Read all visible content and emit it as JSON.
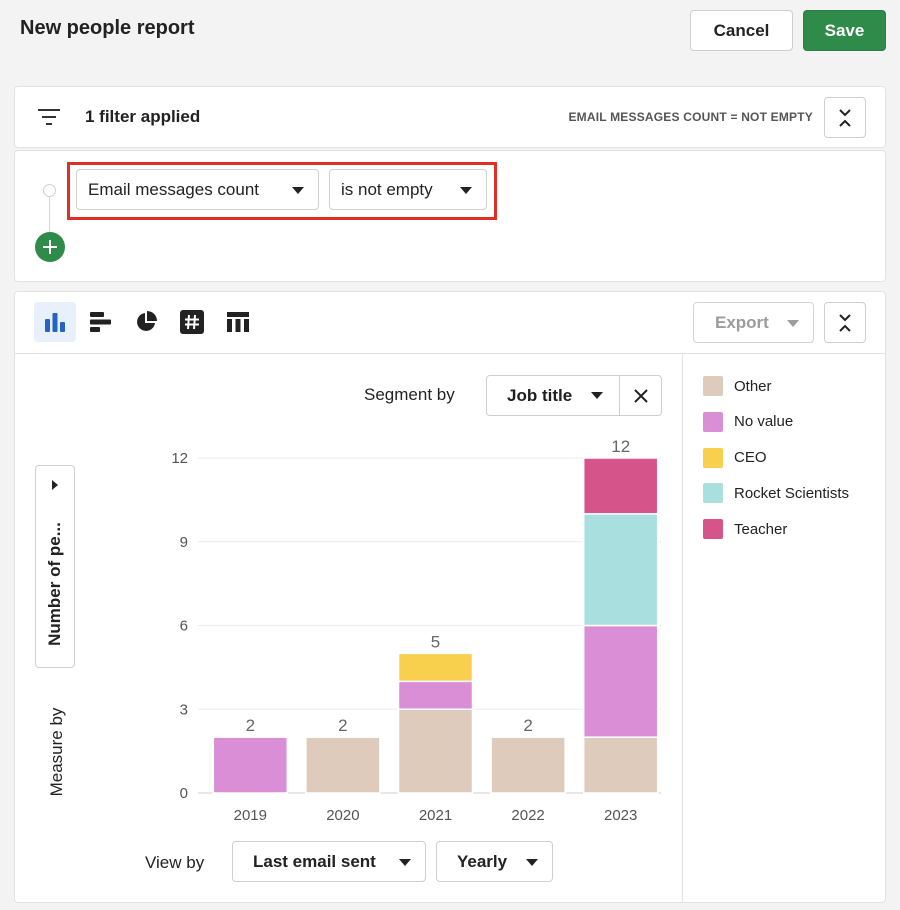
{
  "header": {
    "title": "New people report",
    "cancel_label": "Cancel",
    "save_label": "Save"
  },
  "filter": {
    "count_label": "1 filter applied",
    "summary": "EMAIL MESSAGES COUNT = NOT EMPTY",
    "field": "Email messages count",
    "operator": "is not empty"
  },
  "toolbar": {
    "chart_types": [
      "column-chart-icon",
      "bar-chart-icon",
      "pie-chart-icon",
      "number-icon",
      "table-icon"
    ],
    "active_chart_type": "column-chart-icon",
    "export_label": "Export"
  },
  "segment": {
    "label": "Segment by",
    "value": "Job title"
  },
  "measure": {
    "label": "Measure by",
    "value": "Number of pe..."
  },
  "view": {
    "label": "View by",
    "value": "Last email sent",
    "period": "Yearly"
  },
  "colors": {
    "accent_green": "#2e8b4a",
    "highlight_red": "#e03025"
  },
  "chart_data": {
    "type": "bar",
    "stacked": true,
    "categories": [
      "2019",
      "2020",
      "2021",
      "2022",
      "2023"
    ],
    "series": [
      {
        "name": "Other",
        "color": "#dfcbbb",
        "values": [
          0,
          2,
          3,
          2,
          2
        ]
      },
      {
        "name": "No value",
        "color": "#d98ed6",
        "values": [
          2,
          0,
          1,
          0,
          4
        ]
      },
      {
        "name": "CEO",
        "color": "#f9cf4e",
        "values": [
          0,
          0,
          1,
          0,
          0
        ]
      },
      {
        "name": "Rocket Scientists",
        "color": "#aadfe0",
        "values": [
          0,
          0,
          0,
          0,
          4
        ]
      },
      {
        "name": "Teacher",
        "color": "#d5558a",
        "values": [
          0,
          0,
          0,
          0,
          2
        ]
      }
    ],
    "totals": [
      "2",
      "2",
      "5",
      "2",
      "12"
    ],
    "yticks": [
      "0",
      "3",
      "6",
      "9",
      "12"
    ],
    "ylim": [
      0,
      12
    ],
    "grid": true,
    "legend": "right"
  }
}
